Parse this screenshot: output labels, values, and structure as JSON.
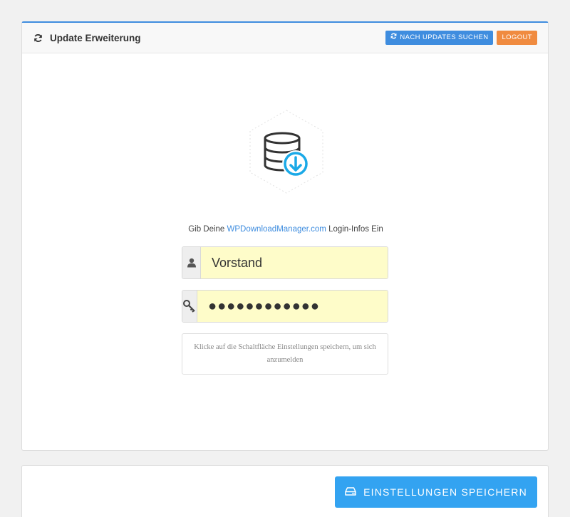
{
  "header": {
    "title": "Update Erweiterung",
    "check_updates_label": "NACH UPDATES SUCHEN",
    "logout_label": "LOGOUT"
  },
  "intro": {
    "prefix": "Gib Deine ",
    "link_text": "WPDownloadManager.com",
    "suffix": " Login-Infos Ein"
  },
  "form": {
    "username_value": "Vorstand",
    "password_value": "●●●●●●●●●●●●"
  },
  "note": "Klicke auf die Schaltfläche Einstellungen speichern, um sich anzumelden",
  "footer": {
    "save_label": "EINSTELLUNGEN SPEICHERN"
  },
  "colors": {
    "accent": "#3f8ddf",
    "logout": "#f08b40",
    "save": "#33a3f1",
    "autofill": "#fefcc9"
  },
  "icons": {
    "header": "refresh-icon",
    "logo": "database-download-icon",
    "username": "user-icon",
    "password": "key-icon",
    "save": "hard-drive-icon"
  }
}
